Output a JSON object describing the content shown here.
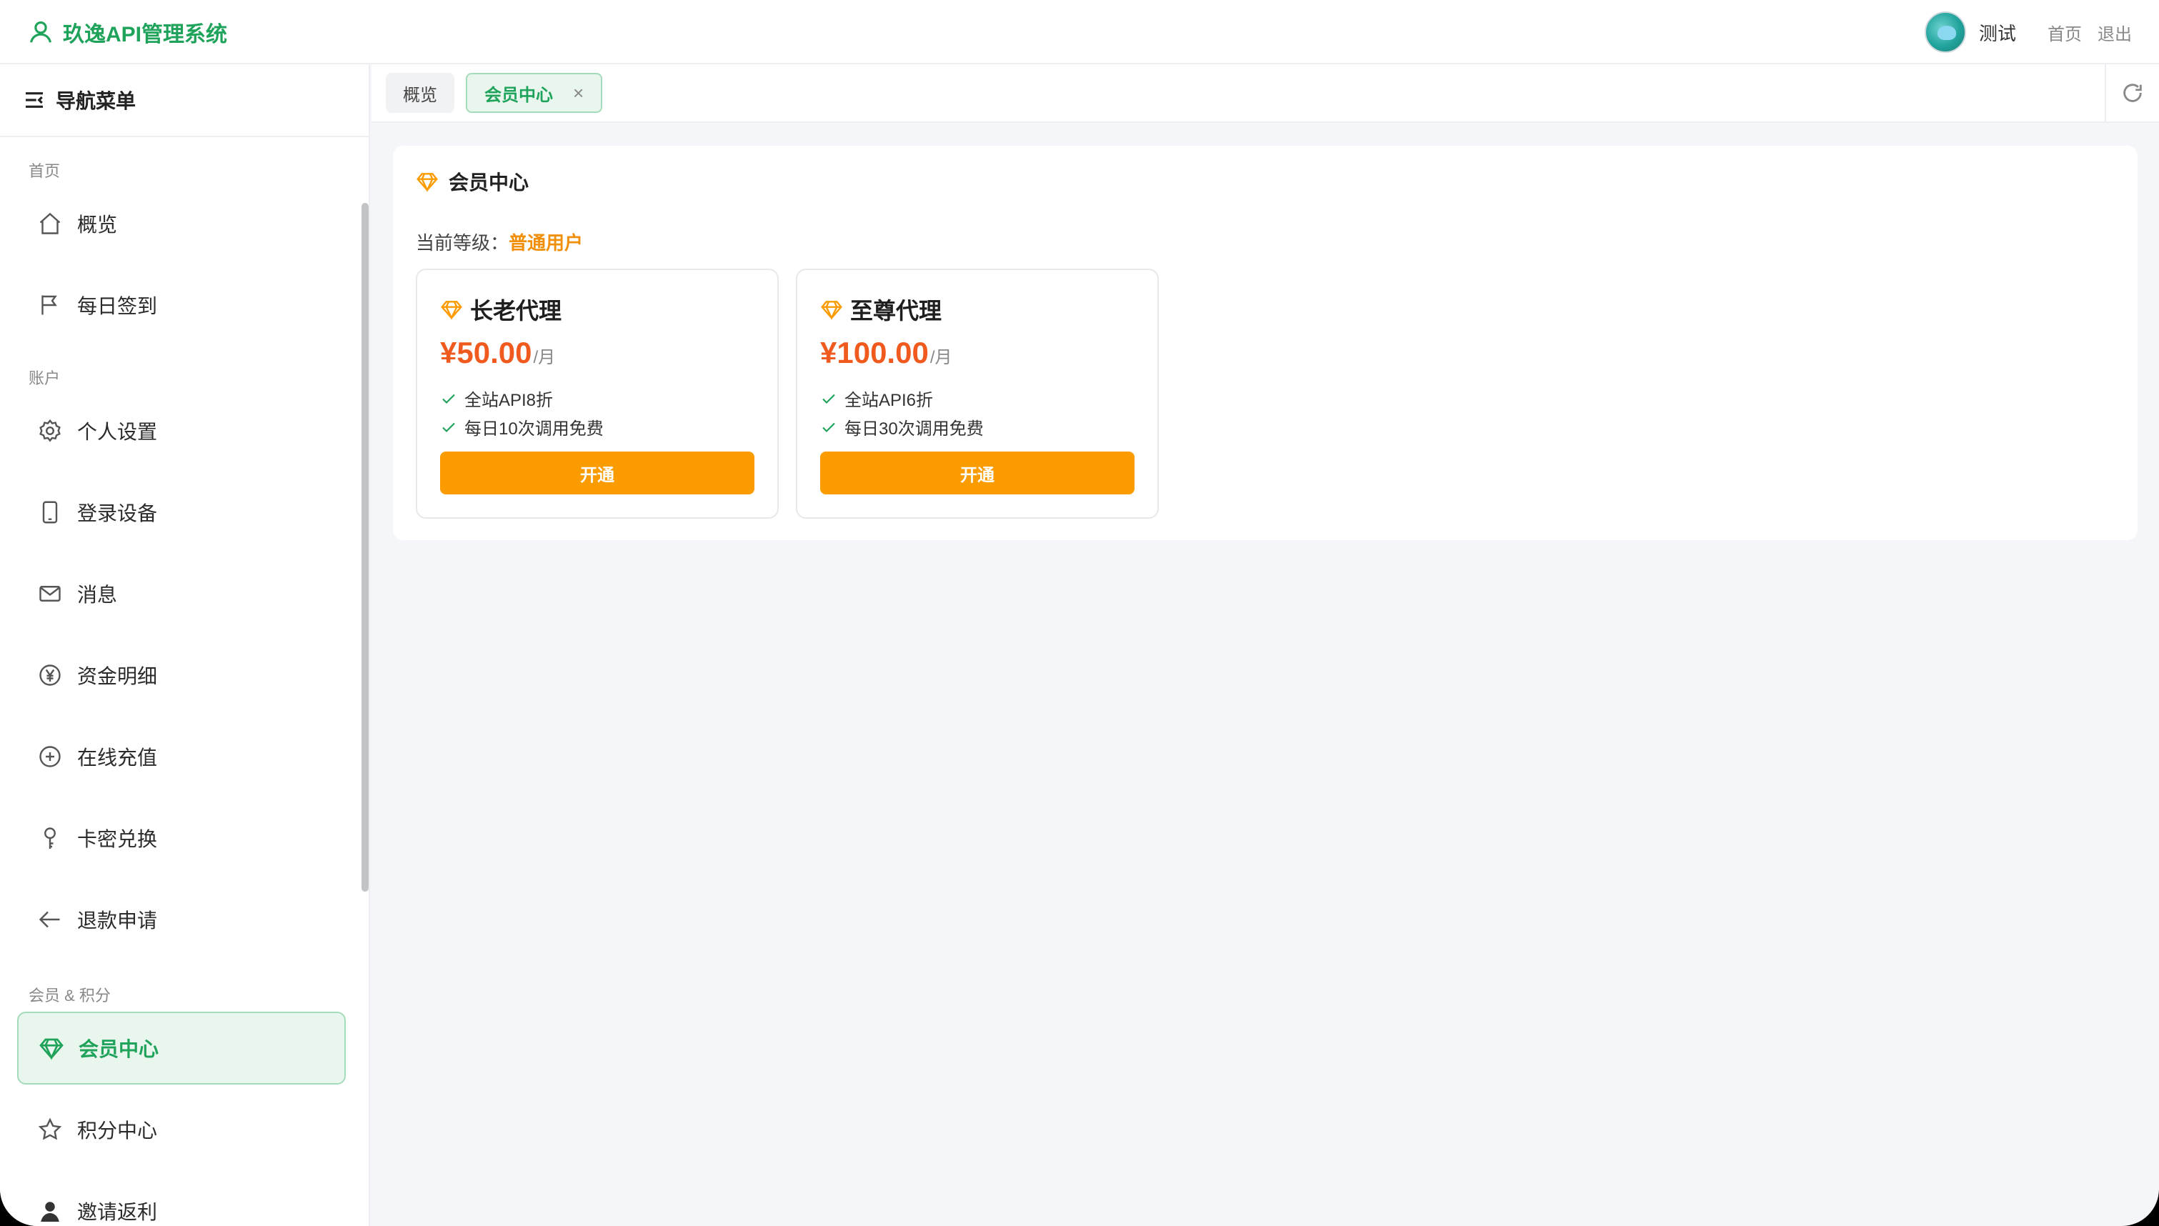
{
  "app": {
    "title": "玖逸API管理系统"
  },
  "header": {
    "user_name": "测试",
    "home_link": "首页",
    "logout_link": "退出"
  },
  "sidebar": {
    "title": "导航菜单",
    "sections": [
      "首页",
      "账户",
      "会员 & 积分"
    ],
    "items": [
      {
        "label": "概览",
        "icon": "home-icon"
      },
      {
        "label": "每日签到",
        "icon": "flag-icon"
      },
      {
        "label": "个人设置",
        "icon": "gear-icon"
      },
      {
        "label": "登录设备",
        "icon": "phone-icon"
      },
      {
        "label": "消息",
        "icon": "mail-icon"
      },
      {
        "label": "资金明细",
        "icon": "yen-icon"
      },
      {
        "label": "在线充值",
        "icon": "plus-circle-icon"
      },
      {
        "label": "卡密兑换",
        "icon": "key-icon"
      },
      {
        "label": "退款申请",
        "icon": "arrow-left-icon"
      },
      {
        "label": "会员中心",
        "icon": "diamond-icon",
        "active": true
      },
      {
        "label": "积分中心",
        "icon": "star-icon"
      },
      {
        "label": "邀请返利",
        "icon": "user-icon"
      }
    ]
  },
  "tabs": [
    {
      "label": "概览"
    },
    {
      "label": "会员中心",
      "active": true,
      "close": "×"
    }
  ],
  "main": {
    "title": "会员中心",
    "level_label": "当前等级：",
    "level_value": "普通用户",
    "plans": [
      {
        "name": "长老代理",
        "price": "¥50.00",
        "unit": "/月",
        "features": [
          "全站API8折",
          "每日10次调用免费"
        ],
        "button": "开通"
      },
      {
        "name": "至尊代理",
        "price": "¥100.00",
        "unit": "/月",
        "features": [
          "全站API6折",
          "每日30次调用免费"
        ],
        "button": "开通"
      }
    ]
  },
  "colors": {
    "brand": "#1fa35b",
    "accent": "#fa9b00",
    "price": "#f05a1e"
  }
}
